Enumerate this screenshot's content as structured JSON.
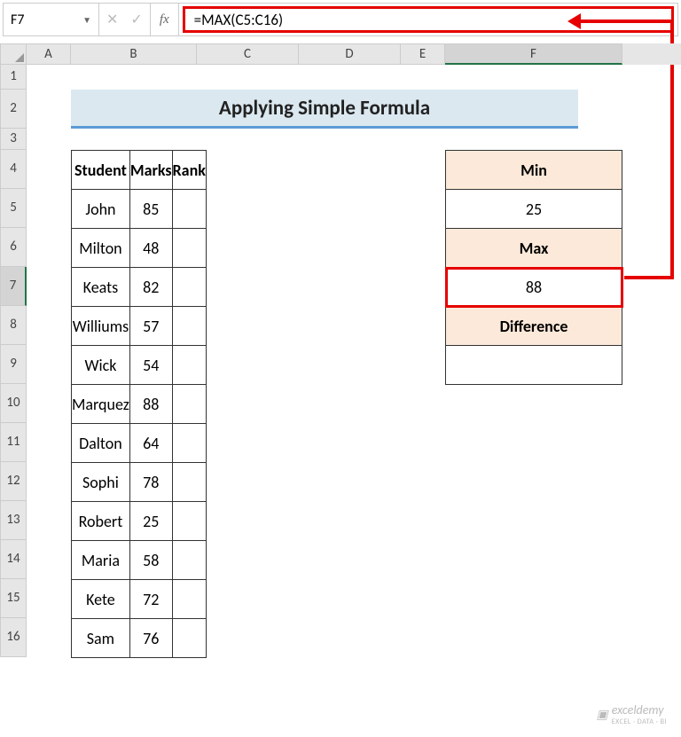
{
  "nameBox": "F7",
  "formula": "=MAX(C5:C16)",
  "fxLabel": "fx",
  "columns": [
    "A",
    "B",
    "C",
    "D",
    "E",
    "F"
  ],
  "rows": [
    "1",
    "2",
    "3",
    "4",
    "5",
    "6",
    "7",
    "8",
    "9",
    "10",
    "11",
    "12",
    "13",
    "14",
    "15",
    "16"
  ],
  "title": "Applying Simple Formula",
  "table": {
    "headers": {
      "student": "Student",
      "marks": "Marks",
      "rank": "Rank"
    },
    "rows": [
      {
        "student": "John",
        "marks": "85"
      },
      {
        "student": "Milton",
        "marks": "48"
      },
      {
        "student": "Keats",
        "marks": "82"
      },
      {
        "student": "Williums",
        "marks": "57"
      },
      {
        "student": "Wick",
        "marks": "54"
      },
      {
        "student": "Marquez",
        "marks": "88"
      },
      {
        "student": "Dalton",
        "marks": "64"
      },
      {
        "student": "Sophi",
        "marks": "78"
      },
      {
        "student": "Robert",
        "marks": "25"
      },
      {
        "student": "Maria",
        "marks": "58"
      },
      {
        "student": "Kete",
        "marks": "72"
      },
      {
        "student": "Sam",
        "marks": "76"
      }
    ]
  },
  "side": {
    "minLabel": "Min",
    "minValue": "25",
    "maxLabel": "Max",
    "maxValue": "88",
    "diffLabel": "Difference",
    "diffValue": ""
  },
  "watermark": {
    "main": "exceldemy",
    "sub": "EXCEL · DATA · BI"
  }
}
